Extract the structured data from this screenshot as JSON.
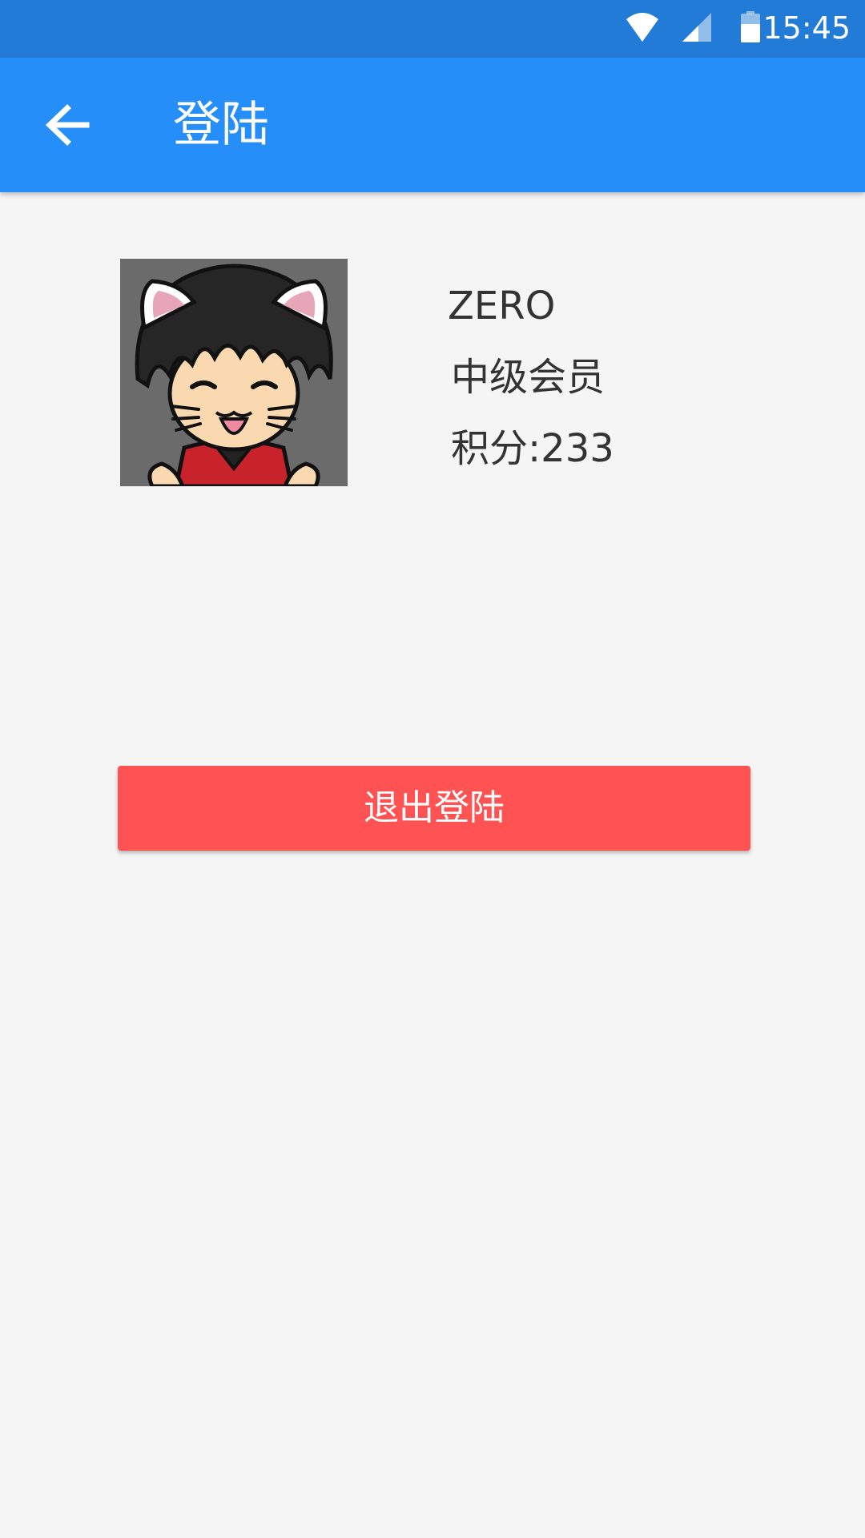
{
  "status_bar": {
    "time": "15:45",
    "icons": [
      "wifi-icon",
      "cell-signal-icon",
      "battery-icon"
    ],
    "background": "#227bd6"
  },
  "toolbar": {
    "back_icon": "arrow-left-icon",
    "title": "登陆",
    "background": "#268ef9"
  },
  "profile": {
    "avatar_icon": "cartoon-cat-ears-avatar",
    "name": "ZERO",
    "level": "中级会员",
    "points_label": "积分:233"
  },
  "logout": {
    "label": "退出登陆",
    "color": "#ff5353"
  },
  "colors": {
    "page_background": "#f5f5f5",
    "text_primary": "#333333"
  }
}
